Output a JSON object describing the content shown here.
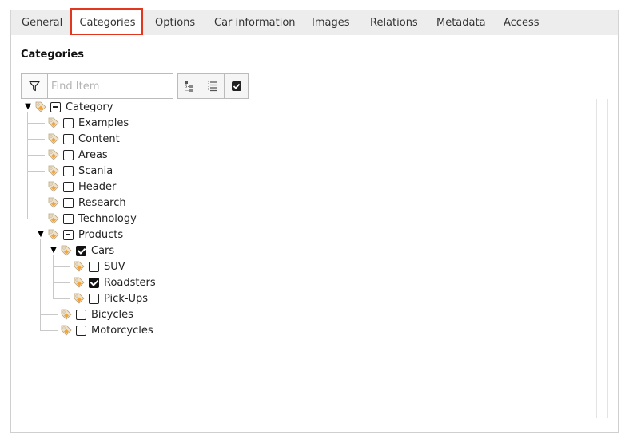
{
  "tabs": [
    {
      "label": "General"
    },
    {
      "label": "Categories"
    },
    {
      "label": "Options"
    },
    {
      "label": "Car information"
    },
    {
      "label": "Images"
    },
    {
      "label": "Relations"
    },
    {
      "label": "Metadata"
    },
    {
      "label": "Access"
    }
  ],
  "active_tab": "Categories",
  "section": {
    "title": "Categories"
  },
  "search": {
    "placeholder": "Find Item",
    "value": ""
  },
  "toolbar_icons": [
    "filter-icon",
    "collapse-tree-icon",
    "expand-list-icon",
    "checked-only-icon"
  ],
  "tree": {
    "nodes": [
      {
        "label": "Category",
        "state": "partial",
        "expanded": true
      },
      {
        "label": "Examples",
        "state": "unchecked"
      },
      {
        "label": "Content",
        "state": "unchecked"
      },
      {
        "label": "Areas",
        "state": "unchecked"
      },
      {
        "label": "Scania",
        "state": "unchecked"
      },
      {
        "label": "Header",
        "state": "unchecked"
      },
      {
        "label": "Research",
        "state": "unchecked"
      },
      {
        "label": "Technology",
        "state": "unchecked"
      },
      {
        "label": "Products",
        "state": "partial",
        "expanded": true
      },
      {
        "label": "Cars",
        "state": "checked",
        "expanded": true
      },
      {
        "label": "SUV",
        "state": "unchecked"
      },
      {
        "label": "Roadsters",
        "state": "checked"
      },
      {
        "label": "Pick-Ups",
        "state": "unchecked"
      },
      {
        "label": "Bicycles",
        "state": "unchecked"
      },
      {
        "label": "Motorcycles",
        "state": "unchecked"
      }
    ]
  },
  "colors": {
    "highlight": "#e2361e",
    "tag_orange": "#f0a43a",
    "tag_body": "#e8dcc4"
  }
}
